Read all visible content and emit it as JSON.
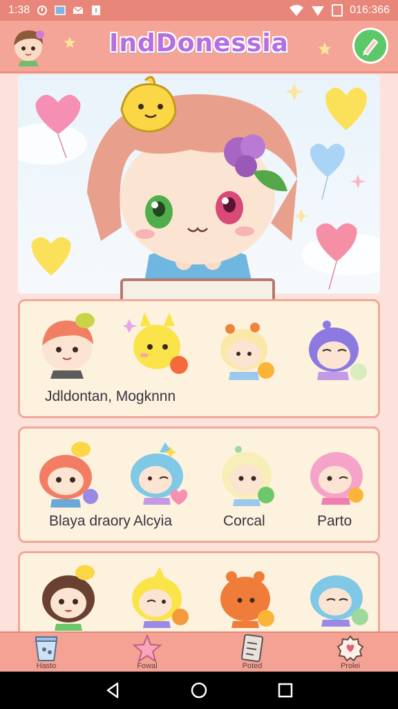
{
  "status_bar": {
    "time": "1:38",
    "right_text": "016:366"
  },
  "header": {
    "title": "IndDonessia"
  },
  "hero": {
    "character": "pink-haired-chibi"
  },
  "cards": [
    {
      "labels": [
        "Jdldontan, Mogknnn"
      ]
    },
    {
      "labels": [
        "Blaya draory",
        "Alcyia",
        "Corcal",
        "Parto"
      ]
    },
    {
      "labels": []
    }
  ],
  "bottom_nav": {
    "items": [
      {
        "label": "Hasto",
        "icon": "bucket-icon"
      },
      {
        "label": "Fowal",
        "icon": "star-icon"
      },
      {
        "label": "Poted",
        "icon": "document-icon"
      },
      {
        "label": "Prolei",
        "icon": "badge-icon"
      }
    ]
  },
  "colors": {
    "header": "#f4a597",
    "status": "#e8867a",
    "card": "#fdf2de",
    "card_border": "#f0a79a",
    "accent": "#b46fe0"
  }
}
